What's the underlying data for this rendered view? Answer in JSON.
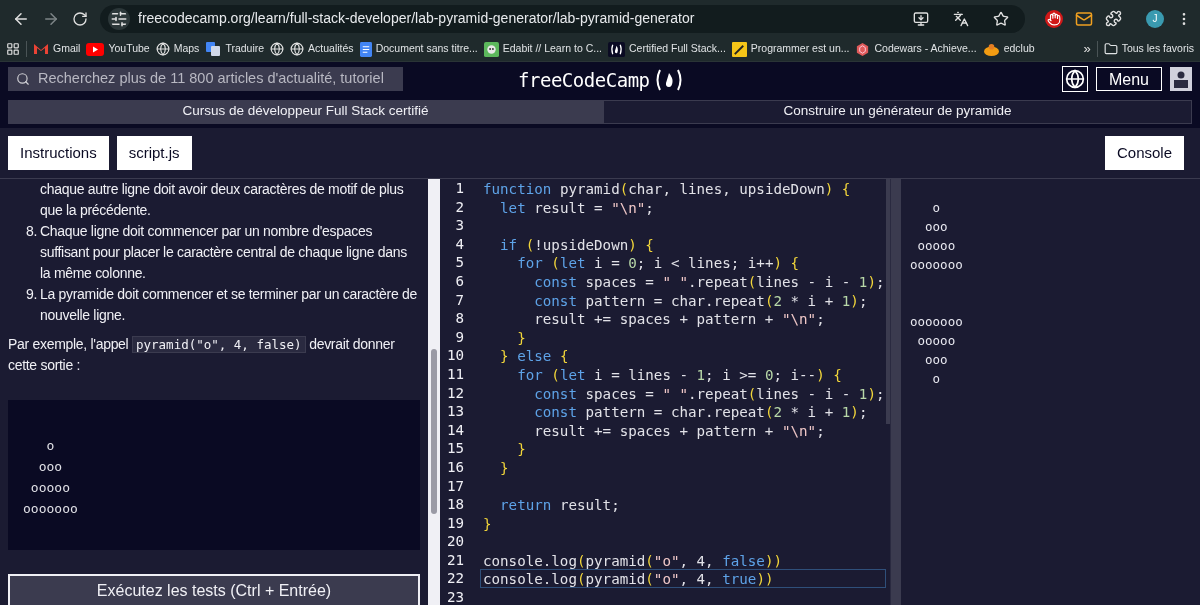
{
  "browser": {
    "url": "freecodecamp.org/learn/full-stack-developer/lab-pyramid-generator/lab-pyramid-generator",
    "profile": "J",
    "bookmarks": [
      {
        "kind": "gmail",
        "label": "Gmail"
      },
      {
        "kind": "youtube",
        "label": "YouTube"
      },
      {
        "kind": "globe",
        "label": "Maps"
      },
      {
        "kind": "translate",
        "label": "Traduire"
      },
      {
        "kind": "globe"
      },
      {
        "kind": "globe",
        "label": "Actualités"
      },
      {
        "kind": "doc",
        "label": "Document sans titre..."
      },
      {
        "kind": "edabit",
        "label": "Edabit // Learn to C..."
      },
      {
        "kind": "fcc",
        "label": "Certified Full Stack..."
      },
      {
        "kind": "pencil",
        "label": "Programmer est un..."
      },
      {
        "kind": "codewars",
        "label": "Codewars - Achieve..."
      },
      {
        "kind": "edclub",
        "label": "edclub"
      }
    ],
    "more": "»",
    "all_bookmarks": "Tous les favoris"
  },
  "nav": {
    "search_placeholder": "Recherchez plus de 11 800 articles d'actualité, tutoriel",
    "logo": "freeCodeCamp",
    "menu": "Menu"
  },
  "breadcrumb": [
    "Cursus de développeur Full Stack certifié",
    "Construire un générateur de pyramide"
  ],
  "tabs": [
    {
      "label": "Instructions"
    },
    {
      "label": "script.js"
    }
  ],
  "console_button": "Console",
  "instructions": {
    "items": [
      {
        "text": "chaque autre ligne doit avoir deux caractères de motif de plus que la précédente."
      },
      {
        "marker": "8.",
        "text": "Chaque ligne doit commencer par un nombre d'espaces suffisant pour placer le caractère central de chaque ligne dans la même colonne."
      },
      {
        "marker": "9.",
        "text": "La pyramide doit commencer et se terminer par un caractère de nouvelle ligne."
      }
    ],
    "example": {
      "before": "Par exemple, l'appel ",
      "code": "pyramid(\"o\", 4, false)",
      "after": "devrait donner cette sortie :"
    },
    "sample_output": [
      "   o",
      "  ooo",
      " ooooo",
      "ooooooo"
    ],
    "run_button": "Exécutez les tests (Ctrl + Entrée)"
  },
  "editor": {
    "lines": [
      {
        "number": "1",
        "active": false,
        "tokens": [
          {
            "kind": "kw",
            "t": "function"
          },
          {
            "kind": "id",
            "t": " pyramid"
          },
          {
            "kind": "br",
            "t": "("
          },
          {
            "kind": "id",
            "t": "char, lines, upsideDown"
          },
          {
            "kind": "br",
            "t": ")"
          },
          {
            "kind": "br",
            "t": " {"
          }
        ]
      },
      {
        "number": "2",
        "active": false,
        "tokens": [
          {
            "kind": "kw",
            "t": "  let"
          },
          {
            "kind": "id",
            "t": " result = "
          },
          {
            "kind": "str",
            "t": "\"\\n\""
          },
          {
            "kind": "id",
            "t": ";"
          }
        ]
      },
      {
        "number": "3",
        "active": false
      },
      {
        "number": "4",
        "active": false,
        "tokens": [
          {
            "kind": "kw",
            "t": "  if"
          },
          {
            "kind": "br",
            "t": " ("
          },
          {
            "kind": "id",
            "t": "!upsideDown"
          },
          {
            "kind": "br",
            "t": ")"
          },
          {
            "kind": "br",
            "t": " {"
          }
        ]
      },
      {
        "number": "5",
        "active": false,
        "tokens": [
          {
            "kind": "kw",
            "t": "    for"
          },
          {
            "kind": "br",
            "t": " ("
          },
          {
            "kind": "kw",
            "t": "let"
          },
          {
            "kind": "id",
            "t": " i = "
          },
          {
            "kind": "num",
            "t": "0"
          },
          {
            "kind": "id",
            "t": "; i < lines; i++"
          },
          {
            "kind": "br",
            "t": ")"
          },
          {
            "kind": "br",
            "t": " {"
          }
        ]
      },
      {
        "number": "6",
        "active": false,
        "tokens": [
          {
            "kind": "kw",
            "t": "      const"
          },
          {
            "kind": "id",
            "t": " spaces = "
          },
          {
            "kind": "str",
            "t": "\" \""
          },
          {
            "kind": "id",
            "t": ".repeat"
          },
          {
            "kind": "br",
            "t": "("
          },
          {
            "kind": "id",
            "t": "lines - i - "
          },
          {
            "kind": "num",
            "t": "1"
          },
          {
            "kind": "br",
            "t": ")"
          },
          {
            "kind": "id",
            "t": ";"
          }
        ]
      },
      {
        "number": "7",
        "active": false,
        "tokens": [
          {
            "kind": "kw",
            "t": "      const"
          },
          {
            "kind": "id",
            "t": " pattern = char.repeat"
          },
          {
            "kind": "br",
            "t": "("
          },
          {
            "kind": "num",
            "t": "2"
          },
          {
            "kind": "id",
            "t": " * i + "
          },
          {
            "kind": "num",
            "t": "1"
          },
          {
            "kind": "br",
            "t": ")"
          },
          {
            "kind": "id",
            "t": ";"
          }
        ]
      },
      {
        "number": "8",
        "active": false,
        "tokens": [
          {
            "kind": "id",
            "t": "      result += spaces + pattern + "
          },
          {
            "kind": "str",
            "t": "\"\\n\""
          },
          {
            "kind": "id",
            "t": ";"
          }
        ]
      },
      {
        "number": "9",
        "active": false,
        "tokens": [
          {
            "kind": "br",
            "t": "    }"
          }
        ]
      },
      {
        "number": "10",
        "active": false,
        "tokens": [
          {
            "kind": "br",
            "t": "  }"
          },
          {
            "kind": "kw",
            "t": " else"
          },
          {
            "kind": "br",
            "t": " {"
          }
        ]
      },
      {
        "number": "11",
        "active": false,
        "tokens": [
          {
            "kind": "kw",
            "t": "    for"
          },
          {
            "kind": "br",
            "t": " ("
          },
          {
            "kind": "kw",
            "t": "let"
          },
          {
            "kind": "id",
            "t": " i = lines - "
          },
          {
            "kind": "num",
            "t": "1"
          },
          {
            "kind": "id",
            "t": "; i >= "
          },
          {
            "kind": "num",
            "t": "0"
          },
          {
            "kind": "id",
            "t": "; i--"
          },
          {
            "kind": "br",
            "t": ")"
          },
          {
            "kind": "br",
            "t": " {"
          }
        ]
      },
      {
        "number": "12",
        "active": false,
        "tokens": [
          {
            "kind": "kw",
            "t": "      const"
          },
          {
            "kind": "id",
            "t": " spaces = "
          },
          {
            "kind": "str",
            "t": "\" \""
          },
          {
            "kind": "id",
            "t": ".repeat"
          },
          {
            "kind": "br",
            "t": "("
          },
          {
            "kind": "id",
            "t": "lines - i - "
          },
          {
            "kind": "num",
            "t": "1"
          },
          {
            "kind": "br",
            "t": ")"
          },
          {
            "kind": "id",
            "t": ";"
          }
        ]
      },
      {
        "number": "13",
        "active": false,
        "tokens": [
          {
            "kind": "kw",
            "t": "      const"
          },
          {
            "kind": "id",
            "t": " pattern = char.repeat"
          },
          {
            "kind": "br",
            "t": "("
          },
          {
            "kind": "num",
            "t": "2"
          },
          {
            "kind": "id",
            "t": " * i + "
          },
          {
            "kind": "num",
            "t": "1"
          },
          {
            "kind": "br",
            "t": ")"
          },
          {
            "kind": "id",
            "t": ";"
          }
        ]
      },
      {
        "number": "14",
        "active": false,
        "tokens": [
          {
            "kind": "id",
            "t": "      result += spaces + pattern + "
          },
          {
            "kind": "str",
            "t": "\"\\n\""
          },
          {
            "kind": "id",
            "t": ";"
          }
        ]
      },
      {
        "number": "15",
        "active": false,
        "tokens": [
          {
            "kind": "br",
            "t": "    }"
          }
        ]
      },
      {
        "number": "16",
        "active": false,
        "tokens": [
          {
            "kind": "br",
            "t": "  }"
          }
        ]
      },
      {
        "number": "17",
        "active": false
      },
      {
        "number": "18",
        "active": false,
        "tokens": [
          {
            "kind": "kw",
            "t": "  return"
          },
          {
            "kind": "id",
            "t": " result;"
          }
        ]
      },
      {
        "number": "19",
        "active": false,
        "tokens": [
          {
            "kind": "br",
            "t": "}"
          }
        ]
      },
      {
        "number": "20",
        "active": false
      },
      {
        "number": "21",
        "active": false,
        "tokens": [
          {
            "kind": "id",
            "t": "console.log"
          },
          {
            "kind": "br",
            "t": "("
          },
          {
            "kind": "id",
            "t": "pyramid"
          },
          {
            "kind": "br",
            "t": "("
          },
          {
            "kind": "str",
            "t": "\"o\""
          },
          {
            "kind": "id",
            "t": ", 4, "
          },
          {
            "kind": "kw",
            "t": "false"
          },
          {
            "kind": "br",
            "t": "))"
          }
        ]
      },
      {
        "number": "22",
        "active": true,
        "tokens": [
          {
            "kind": "id",
            "t": "console.log"
          },
          {
            "kind": "br",
            "t": "("
          },
          {
            "kind": "id",
            "t": "pyramid"
          },
          {
            "kind": "br",
            "t": "("
          },
          {
            "kind": "str",
            "t": "\"o\""
          },
          {
            "kind": "id",
            "t": ", 4, "
          },
          {
            "kind": "kw",
            "t": "true"
          },
          {
            "kind": "br",
            "t": "))"
          }
        ]
      },
      {
        "number": "23",
        "active": false
      }
    ]
  },
  "preview": {
    "outputs": [
      [
        "   o",
        "  ooo",
        " ooooo",
        "ooooooo"
      ],
      [
        "ooooooo",
        " ooooo",
        "  ooo",
        "   o"
      ]
    ]
  }
}
